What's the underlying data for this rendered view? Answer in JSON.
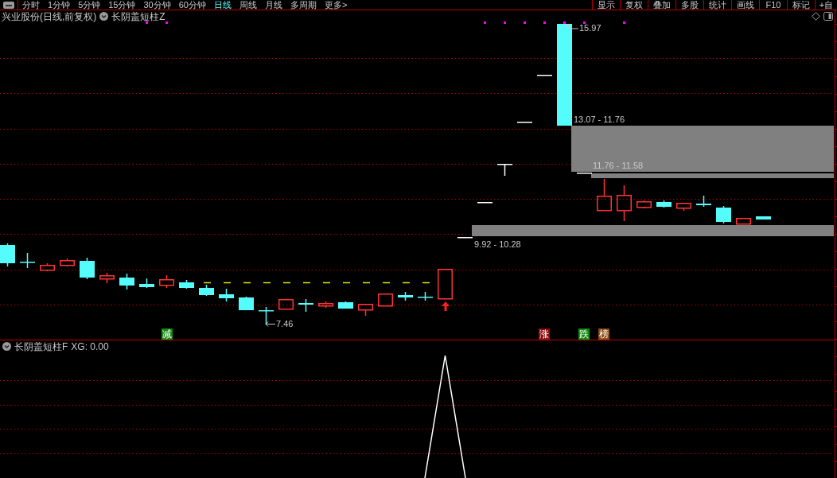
{
  "toolbar": {
    "periods": [
      {
        "label": "分时",
        "selected": false
      },
      {
        "label": "1分钟",
        "selected": false
      },
      {
        "label": "5分钟",
        "selected": false
      },
      {
        "label": "15分钟",
        "selected": false
      },
      {
        "label": "30分钟",
        "selected": false
      },
      {
        "label": "60分钟",
        "selected": false
      },
      {
        "label": "日线",
        "selected": true
      },
      {
        "label": "周线",
        "selected": false
      },
      {
        "label": "月线",
        "selected": false
      },
      {
        "label": "多周期",
        "selected": false
      },
      {
        "label": "更多>",
        "selected": false
      }
    ],
    "tools": [
      "显示",
      "复权",
      "叠加",
      "多股",
      "统计",
      "画线",
      "F10",
      "标记",
      "+自"
    ]
  },
  "chart": {
    "title": "兴业股份(日线,前复权)",
    "indicator": "长阴盖短柱Z",
    "annotations": [
      {
        "kind": "high",
        "value": "15.97"
      },
      {
        "kind": "low",
        "value": "7.46"
      }
    ],
    "zones": [
      {
        "label": "13.07 - 11.76"
      },
      {
        "label": "11.76 - 11.58"
      },
      {
        "label": "9.92 - 10.28"
      }
    ],
    "markers": [
      {
        "label": "减",
        "color": "#138a13"
      },
      {
        "label": "涨",
        "color": "#8c0a0a"
      },
      {
        "label": "跌",
        "color": "#0c8a0c"
      },
      {
        "label": "榜",
        "color": "#8b4a12"
      }
    ]
  },
  "sub_chart": {
    "title": "长阴盖短柱F",
    "reading": "XG: 0.00"
  }
}
